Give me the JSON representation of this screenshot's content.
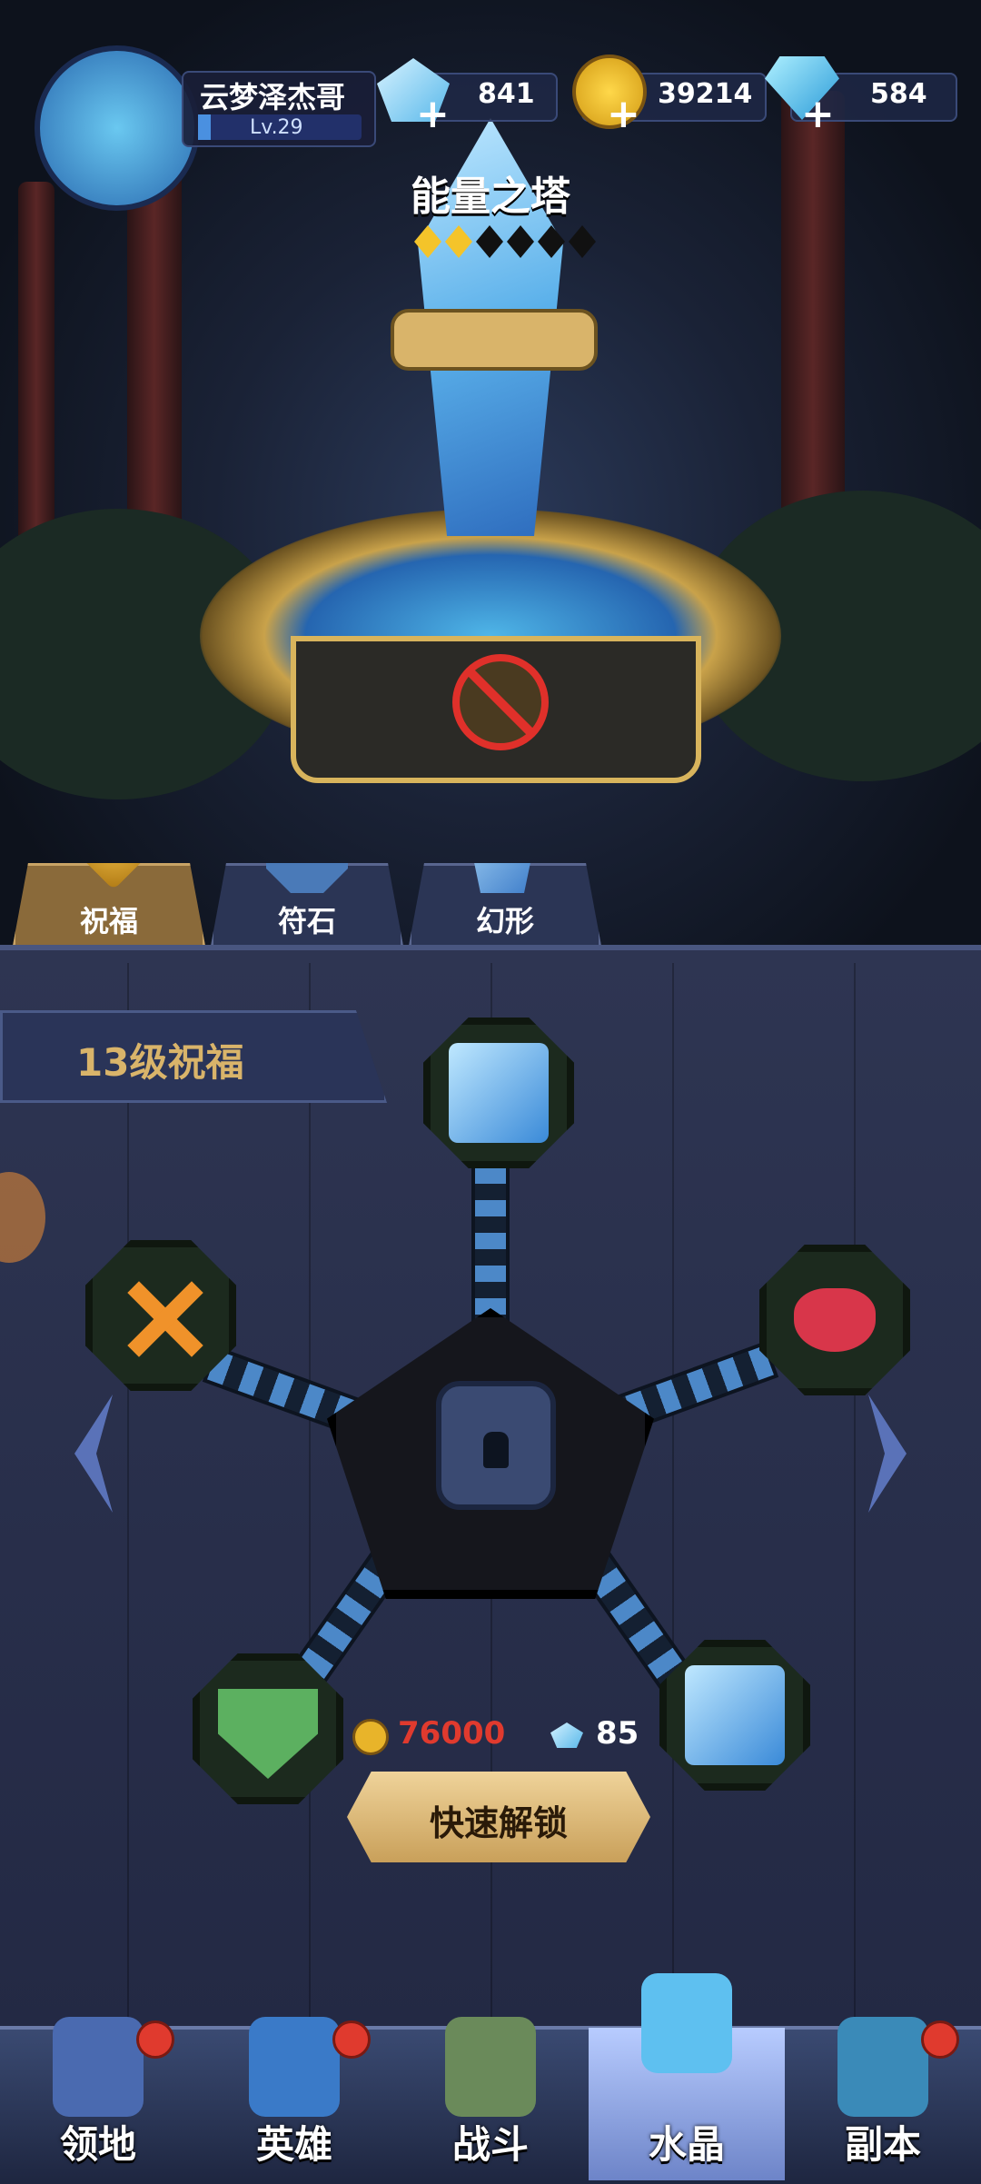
{
  "player": {
    "name": "云梦泽杰哥",
    "level": "Lv.29"
  },
  "currencies": {
    "crystal": "841",
    "gold": "39214",
    "diamond": "584"
  },
  "tower": {
    "title": "能量之塔",
    "stars_filled": 2,
    "stars_total": 6
  },
  "tabs": [
    {
      "label": "祝福",
      "active": true
    },
    {
      "label": "符石",
      "active": false
    },
    {
      "label": "幻形",
      "active": false
    }
  ],
  "blessing": {
    "title": "13级祝福"
  },
  "cost": {
    "gold": "76000",
    "crystal": "85"
  },
  "unlock_button": "快速解锁",
  "nav": [
    {
      "label": "领地",
      "badge": true,
      "active": false
    },
    {
      "label": "英雄",
      "badge": true,
      "active": false
    },
    {
      "label": "战斗",
      "badge": false,
      "active": false
    },
    {
      "label": "水晶",
      "badge": false,
      "active": true
    },
    {
      "label": "副本",
      "badge": true,
      "active": false
    }
  ],
  "colors": {
    "gold_cost": "#e03a2e",
    "accent": "#d9b46a",
    "crystal": "#5ec0f0"
  }
}
